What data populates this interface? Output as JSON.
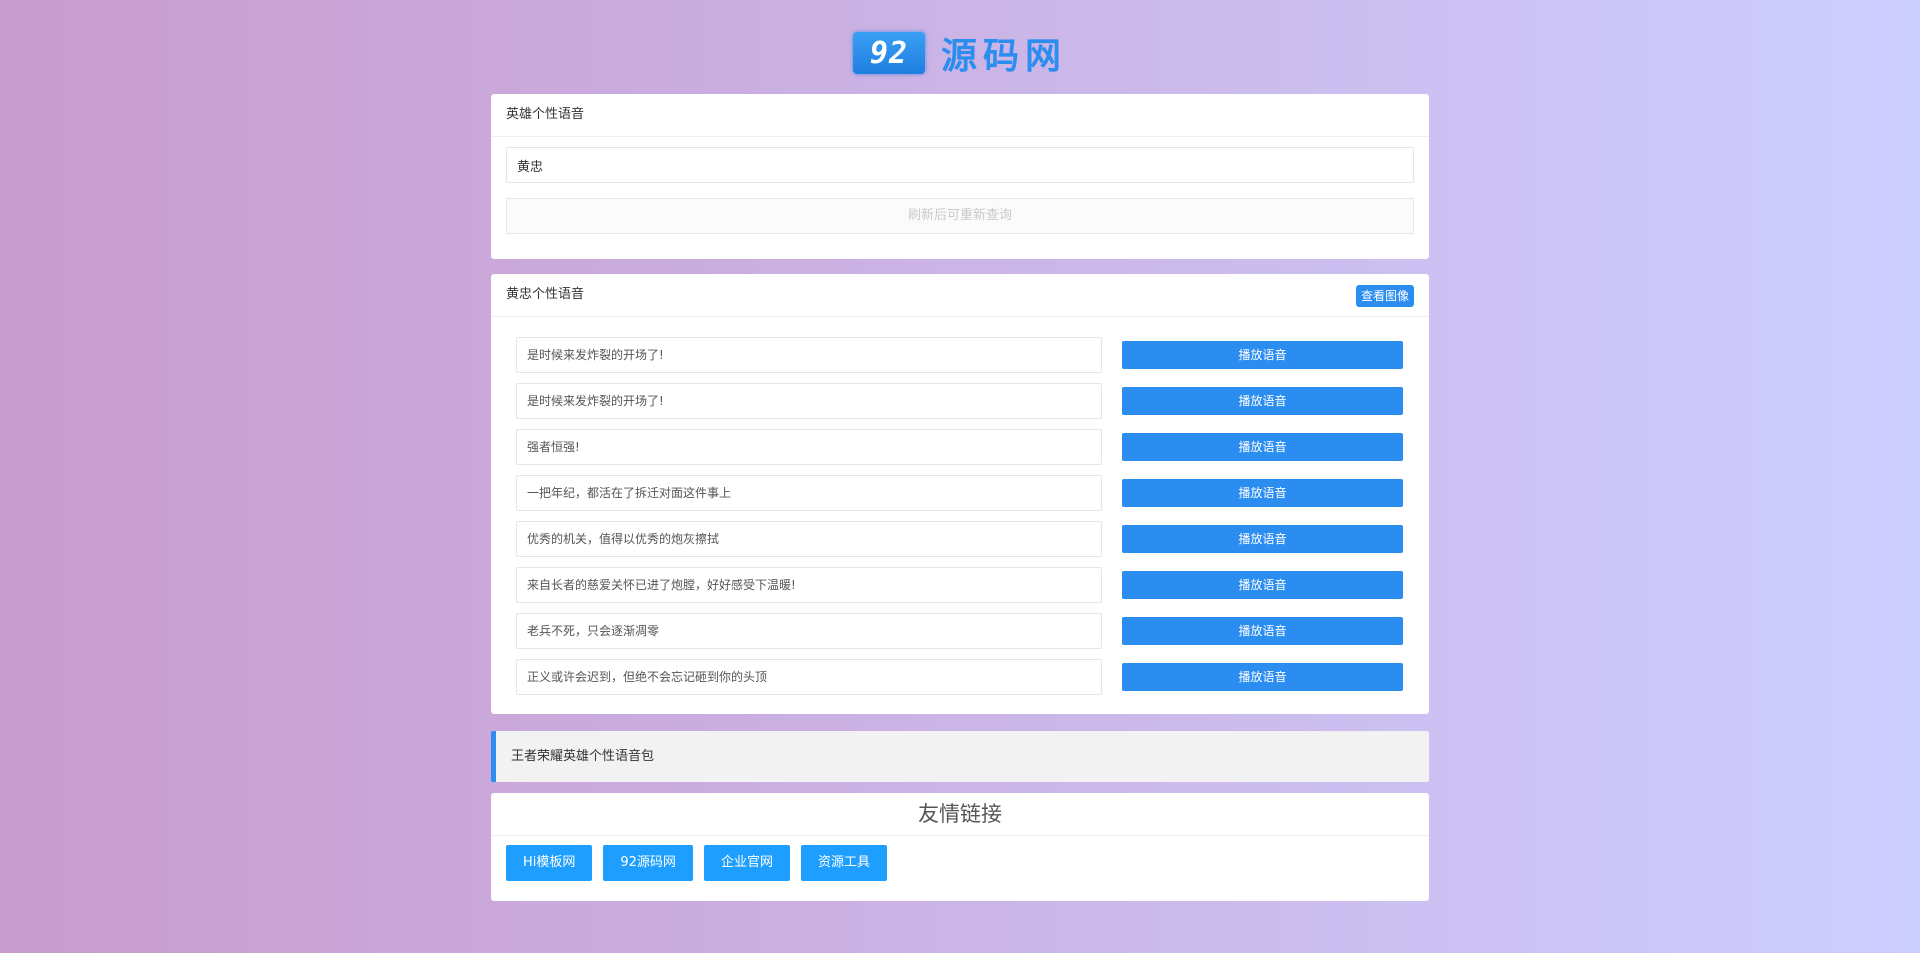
{
  "logo": {
    "badge": "92",
    "text": "源码网"
  },
  "search_panel": {
    "title": "英雄个性语音",
    "input_value": "黄忠",
    "refresh_label": "刷新后可重新查询"
  },
  "voice_panel": {
    "title": "黄忠个性语音",
    "view_image_label": "查看图像",
    "play_label": "播放语音",
    "lines": [
      "是时候来发炸裂的开场了!",
      "是时候来发炸裂的开场了!",
      "强者恒强!",
      "一把年纪，都活在了拆迁对面这件事上",
      "优秀的机关，值得以优秀的炮灰擦拭",
      "来自长者的慈爱关怀已进了炮膛，好好感受下温暖!",
      "老兵不死，只会逐渐凋零",
      "正义或许会迟到，但绝不会忘记砸到你的头顶"
    ]
  },
  "notice": {
    "text": "王者荣耀英雄个性语音包"
  },
  "links_panel": {
    "title": "友情链接",
    "links": [
      "Hi模板网",
      "92源码网",
      "企业官网",
      "资源工具"
    ]
  },
  "colors": {
    "accent": "#2b8df0",
    "link_button": "#1e9fff"
  }
}
